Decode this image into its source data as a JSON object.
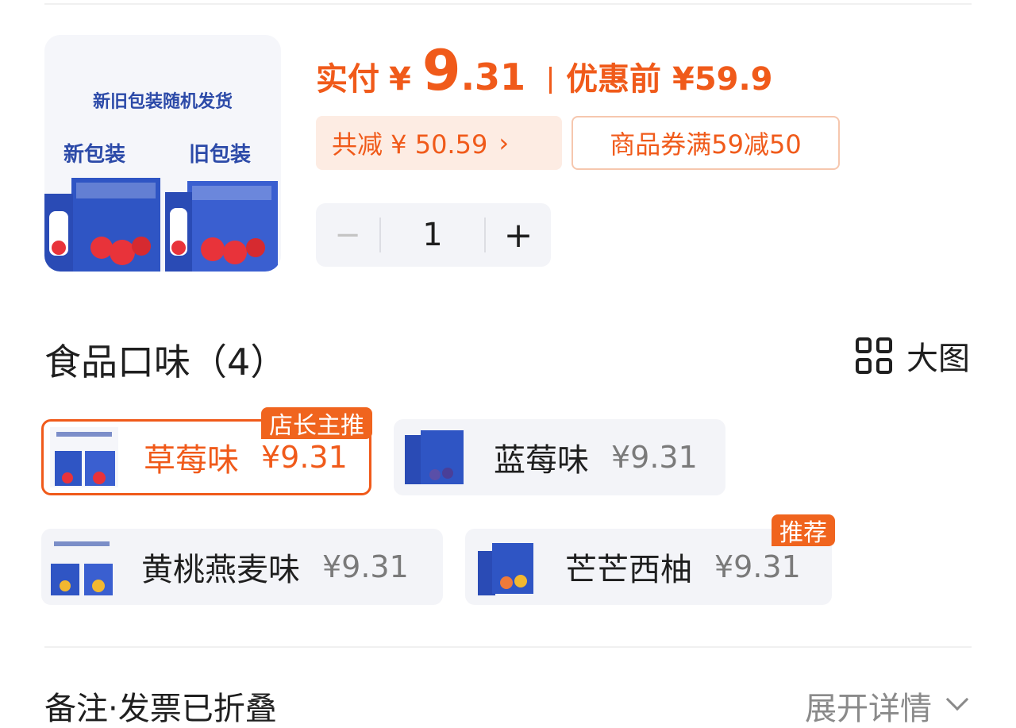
{
  "product_image": {
    "banner": "新旧包装随机发货",
    "new_label": "新包装",
    "old_label": "旧包装"
  },
  "price": {
    "label": "实付",
    "currency": "¥",
    "integer": "9",
    "decimal": ".31",
    "before_label": "优惠前 ¥59.9"
  },
  "discount": {
    "total": "共减 ¥ 50.59",
    "arrow": "›",
    "coupon": "商品券满59减50"
  },
  "quantity": {
    "minus": "−",
    "value": "1",
    "plus": "+"
  },
  "flavor_section": {
    "title": "食品口味（4）",
    "view_toggle": "大图"
  },
  "flavors": [
    {
      "name": "草莓味",
      "price": "¥9.31",
      "badge": "店长主推",
      "selected": true
    },
    {
      "name": "蓝莓味",
      "price": "¥9.31",
      "badge": "",
      "selected": false
    },
    {
      "name": "黄桃燕麦味",
      "price": "¥9.31",
      "badge": "",
      "selected": false
    },
    {
      "name": "芒芒西柚",
      "price": "¥9.31",
      "badge": "推荐",
      "selected": false
    }
  ],
  "footer": {
    "remark": "备注·发票已折叠",
    "expand": "展开详情"
  },
  "colors": {
    "accent": "#f05a1a",
    "brand_blue": "#2c4aa8",
    "chip_bg": "#f3f4f8"
  }
}
